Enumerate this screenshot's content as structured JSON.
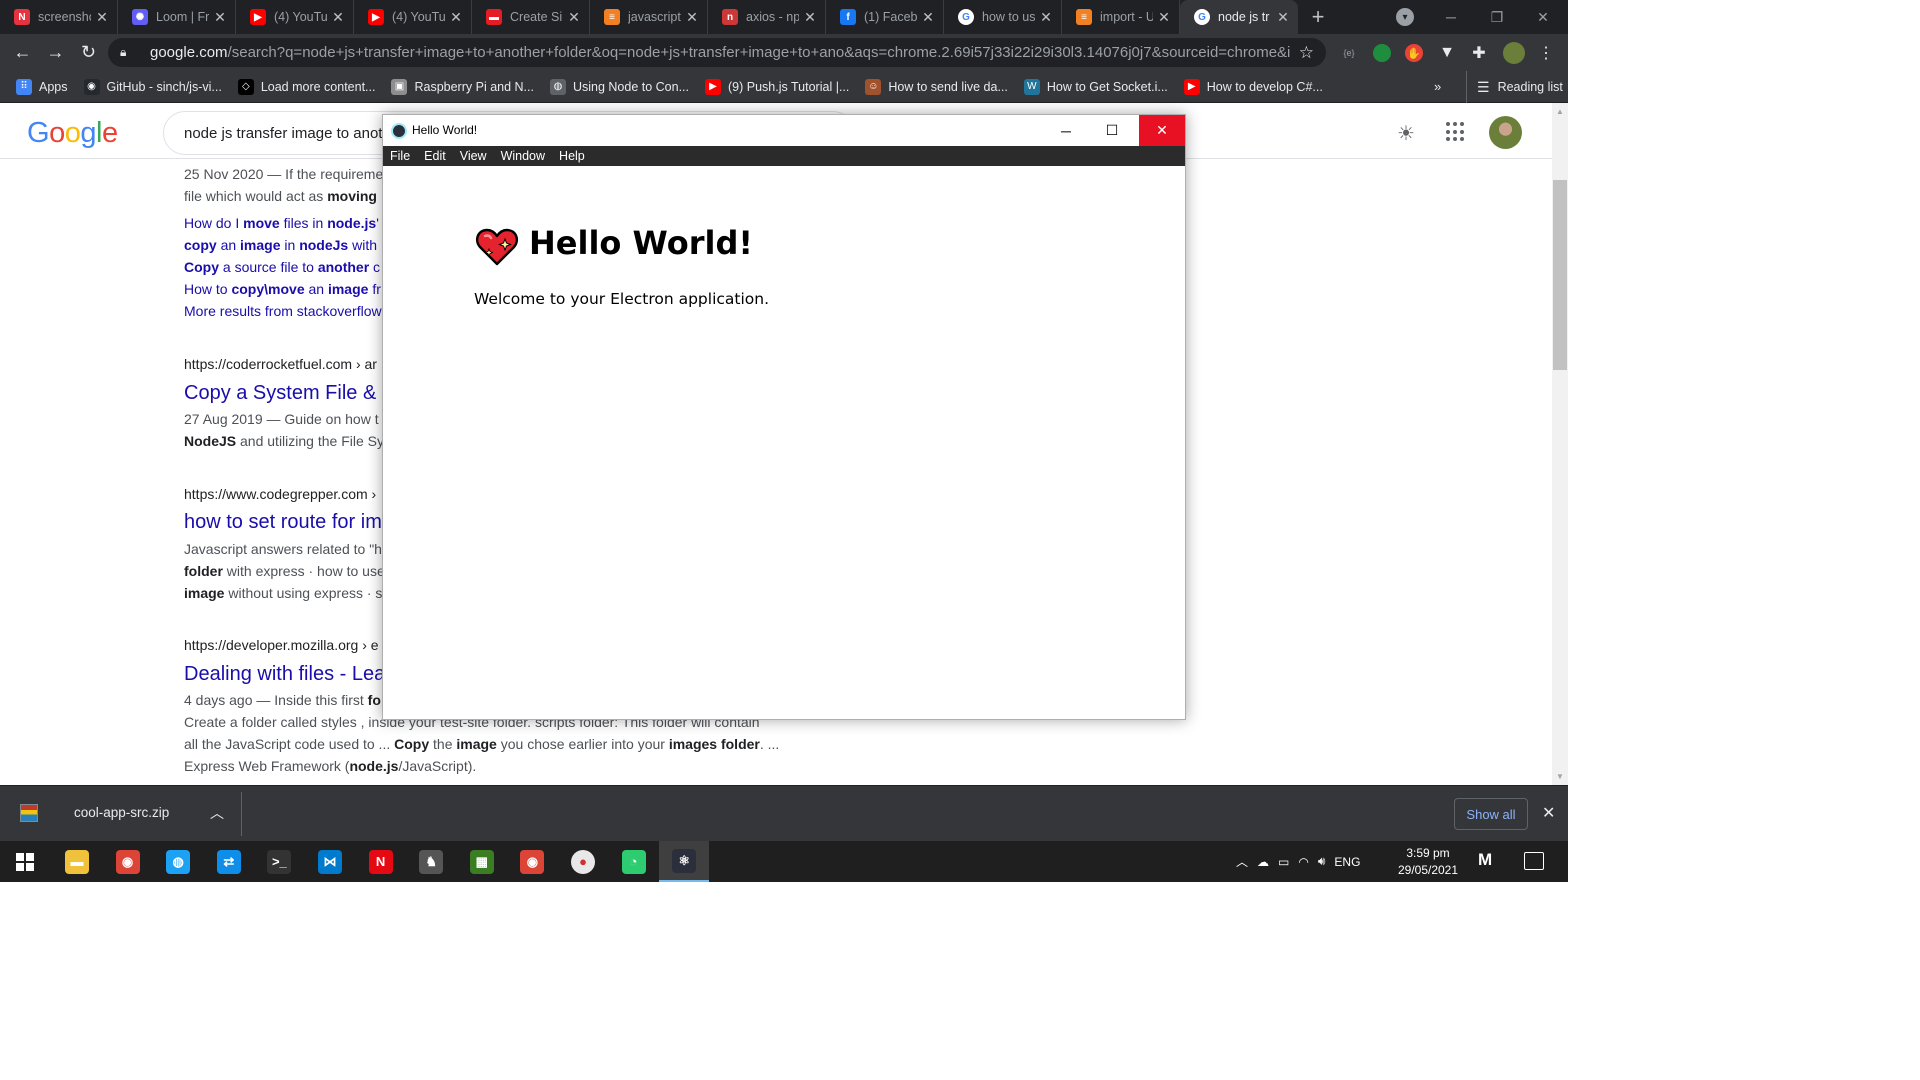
{
  "browser": {
    "tabs": [
      {
        "title": "screensho",
        "icon": "notion-icon",
        "color": "#e7333f",
        "glyph": "N"
      },
      {
        "title": "Loom | Fr",
        "icon": "loom-icon",
        "color": "#625df5",
        "glyph": "✺"
      },
      {
        "title": "(4) YouTu",
        "icon": "youtube-icon",
        "color": "#ff0000",
        "glyph": "▶"
      },
      {
        "title": "(4) YouTu",
        "icon": "youtube-icon",
        "color": "#ff0000",
        "glyph": "▶"
      },
      {
        "title": "Create Sir",
        "icon": "app-icon",
        "color": "#e51c23",
        "glyph": "▬"
      },
      {
        "title": "javascript",
        "icon": "stackoverflow-icon",
        "color": "#f48024",
        "glyph": "≡"
      },
      {
        "title": "axios - np",
        "icon": "npm-icon",
        "color": "#cb3837",
        "glyph": "n"
      },
      {
        "title": "(1) Faceb",
        "icon": "facebook-icon",
        "color": "#1877f2",
        "glyph": "f"
      },
      {
        "title": "how to us",
        "icon": "google-icon",
        "color": "#ffffff",
        "glyph": "G"
      },
      {
        "title": "import - U",
        "icon": "stackoverflow-icon",
        "color": "#f48024",
        "glyph": "≡"
      },
      {
        "title": "node js tr",
        "icon": "google-icon",
        "color": "#ffffff",
        "glyph": "G",
        "active": true
      }
    ],
    "url_main": "google.com",
    "url_rest": "/search?q=node+js+transfer+image+to+another+folder&oq=node+js+transfer+image+to+ano&aqs=chrome.2.69i57j33i22i29i30l3.14076j0j7&sourceid=chrome&ie=...",
    "bookmarks": [
      {
        "label": "Apps",
        "icon": "apps-grid-icon",
        "color": "#4285f4",
        "glyph": "⠿"
      },
      {
        "label": "GitHub - sinch/js-vi...",
        "icon": "github-icon",
        "color": "#24292e",
        "glyph": "◉"
      },
      {
        "label": "Load more content...",
        "icon": "codepen-icon",
        "color": "#000000",
        "glyph": "◇"
      },
      {
        "label": "Raspberry Pi and N...",
        "icon": "image-icon",
        "color": "#8e8e8e",
        "glyph": "▣"
      },
      {
        "label": "Using Node to Con...",
        "icon": "globe-icon",
        "color": "#5f6368",
        "glyph": "◍"
      },
      {
        "label": "(9) Push.js Tutorial |...",
        "icon": "youtube-icon",
        "color": "#ff0000",
        "glyph": "▶"
      },
      {
        "label": "How to send live da...",
        "icon": "avatar-icon",
        "color": "#a0522d",
        "glyph": "☺"
      },
      {
        "label": "How to Get Socket.i...",
        "icon": "wordpress-icon",
        "color": "#21759b",
        "glyph": "W"
      },
      {
        "label": "How to develop C#...",
        "icon": "youtube-icon",
        "color": "#ff0000",
        "glyph": "▶"
      }
    ],
    "bookmarks_more": "»",
    "reading_list": "Reading list"
  },
  "google": {
    "logo": "Google",
    "query": "node js transfer image to anoth",
    "results": {
      "r1_date": "25 Nov 2020",
      "r1_snip_a": " — If the requireme",
      "r1_line2_a": "file which would act as ",
      "r1_line2_b": "moving",
      "links": [
        {
          "pre": "How do I ",
          "b1": "move",
          "mid": " files in ",
          "b2": "node.js",
          "post": "'"
        },
        {
          "pre": "",
          "b1": "copy",
          "mid": " an ",
          "b2": "image",
          "post": " in ",
          "b3": "nodeJs",
          "post2": " with"
        },
        {
          "pre": "",
          "b1": "Copy",
          "mid": " a source file to ",
          "b2": "another",
          "post": " c"
        },
        {
          "pre": "How to ",
          "b1": "copy\\move",
          "mid": " an ",
          "b2": "image",
          "post": " fr"
        },
        {
          "pre": "More results from stackoverflow",
          "b1": "",
          "mid": "",
          "b2": "",
          "post": ""
        }
      ],
      "r2_cite": "https://coderrocketfuel.com › ar",
      "r2_title": "Copy a System File &",
      "r2_date": "27 Aug 2019",
      "r2_snip_a": " — Guide on how t",
      "r2_line2_b": "NodeJS",
      "r2_line2_a": " and utilizing the File Sy",
      "r3_cite": "https://www.codegrepper.com ›",
      "r3_title": "how to set route for im",
      "r3_snip1": "Javascript answers related to \"h",
      "r3_l2_b": "folder",
      "r3_l2_a": " with express · how to use",
      "r3_l3_b": "image",
      "r3_l3_a": " without using express · s",
      "r4_cite": "https://developer.mozilla.org › e",
      "r4_title": "Dealing with files - Lea",
      "r4_date": "4 days ago",
      "r4_snip_a": " — Inside this first ",
      "r4_snip_b": "fo",
      "r4_l2": "Create a folder called styles , inside your test-site folder. scripts folder: This folder will contain",
      "r4_l3_a": "all the JavaScript code used to ... ",
      "r4_l3_b1": "Copy",
      "r4_l3_c": " the ",
      "r4_l3_b2": "image",
      "r4_l3_d": " you chose earlier into your ",
      "r4_l3_b3": "images folder",
      "r4_l3_e": ". ...",
      "r4_l4_a": "Express Web Framework (",
      "r4_l4_b": "node.js",
      "r4_l4_c": "/JavaScript)."
    }
  },
  "electron": {
    "title": "Hello World!",
    "menu": [
      "File",
      "Edit",
      "View",
      "Window",
      "Help"
    ],
    "heading": "Hello World!",
    "welcome": "Welcome to your Electron application.",
    "close_color": "#e81123"
  },
  "downloads": {
    "file": "cool-app-src.zip",
    "show_all": "Show all"
  },
  "taskbar": {
    "apps": [
      {
        "name": "file-explorer-icon",
        "color": "#f0c23b",
        "glyph": "▬"
      },
      {
        "name": "chrome-icon",
        "color": "#db4437",
        "glyph": "◉"
      },
      {
        "name": "edge-icon",
        "color": "#1da1f2",
        "glyph": "◍"
      },
      {
        "name": "teamviewer-icon",
        "color": "#0e8ee9",
        "glyph": "⇄"
      },
      {
        "name": "terminal-icon",
        "color": "#333333",
        "glyph": ">_"
      },
      {
        "name": "vscode-icon",
        "color": "#007acc",
        "glyph": "⋈"
      },
      {
        "name": "netflix-icon",
        "color": "#e50914",
        "glyph": "N"
      },
      {
        "name": "game-icon",
        "color": "#555555",
        "glyph": "♞"
      },
      {
        "name": "app-icon",
        "color": "#3b7d23",
        "glyph": "▦"
      },
      {
        "name": "chrome-icon",
        "color": "#db4437",
        "glyph": "◉"
      },
      {
        "name": "record-icon",
        "color": "#e8e8e8",
        "glyph": "●"
      },
      {
        "name": "timer-icon",
        "color": "#2ecc71",
        "glyph": "◔"
      },
      {
        "name": "electron-icon",
        "color": "#2b2e3b",
        "glyph": "⚛",
        "active": true
      }
    ],
    "lang": "ENG",
    "time": "3:59 pm",
    "date": "29/05/2021"
  }
}
